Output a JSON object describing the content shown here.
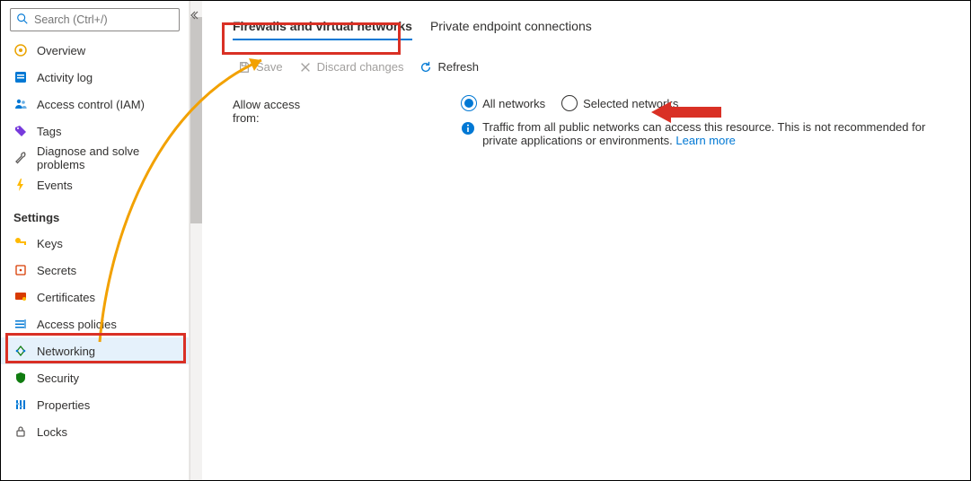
{
  "search": {
    "placeholder": "Search (Ctrl+/)"
  },
  "sidebar": {
    "items": [
      {
        "label": "Overview"
      },
      {
        "label": "Activity log"
      },
      {
        "label": "Access control (IAM)"
      },
      {
        "label": "Tags"
      },
      {
        "label": "Diagnose and solve problems"
      },
      {
        "label": "Events"
      }
    ],
    "section": "Settings",
    "settings": [
      {
        "label": "Keys"
      },
      {
        "label": "Secrets"
      },
      {
        "label": "Certificates"
      },
      {
        "label": "Access policies"
      },
      {
        "label": "Networking"
      },
      {
        "label": "Security"
      },
      {
        "label": "Properties"
      },
      {
        "label": "Locks"
      }
    ]
  },
  "tabs": {
    "firewalls": "Firewalls and virtual networks",
    "private": "Private endpoint connections"
  },
  "toolbar": {
    "save": "Save",
    "discard": "Discard changes",
    "refresh": "Refresh"
  },
  "access": {
    "label": "Allow access from:",
    "all": "All networks",
    "selected": "Selected networks",
    "info": "Traffic from all public networks can access this resource. This is not recommended for private applications or environments.",
    "learn": "Learn more"
  }
}
